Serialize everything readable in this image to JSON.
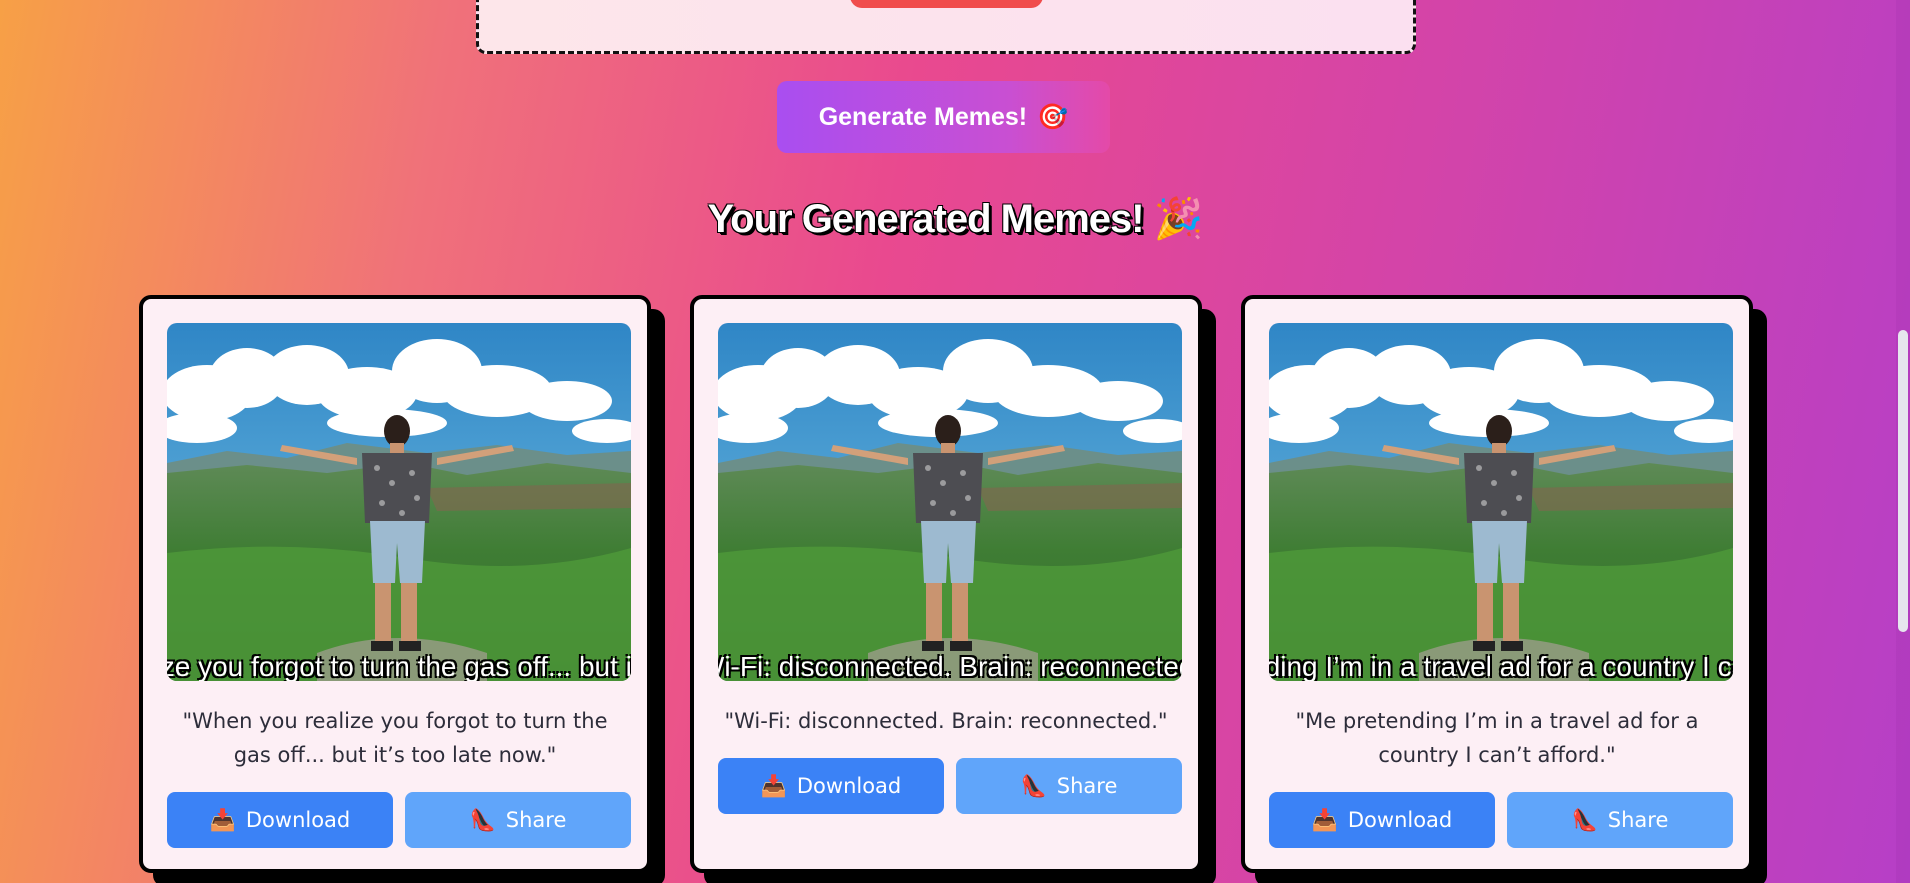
{
  "upload": {},
  "generate_button": {
    "label": "Generate Memes!",
    "icon": "🎯"
  },
  "results": {
    "title": "Your Generated Memes!",
    "title_emoji": "🎉"
  },
  "memes": [
    {
      "overlay_text": "When you realize you forgot to turn the gas off... but it's too late now.",
      "caption": "\"When you realize you forgot to turn the gas off... but it’s too late now.\"",
      "download_label": "Download",
      "download_icon": "📥",
      "share_label": "Share",
      "share_icon": "👠"
    },
    {
      "overlay_text": "Wi-Fi: disconnected. Brain: reconnected.",
      "caption": "\"Wi-Fi: disconnected. Brain: reconnected.\"",
      "download_label": "Download",
      "download_icon": "📥",
      "share_label": "Share",
      "share_icon": "👠"
    },
    {
      "overlay_text": "Me pretending I’m in a travel ad for a country I can’t afford.",
      "caption": "\"Me pretending I’m in a travel ad for a country I can’t afford.\"",
      "download_label": "Download",
      "download_icon": "📥",
      "share_label": "Share",
      "share_icon": "👠"
    }
  ]
}
